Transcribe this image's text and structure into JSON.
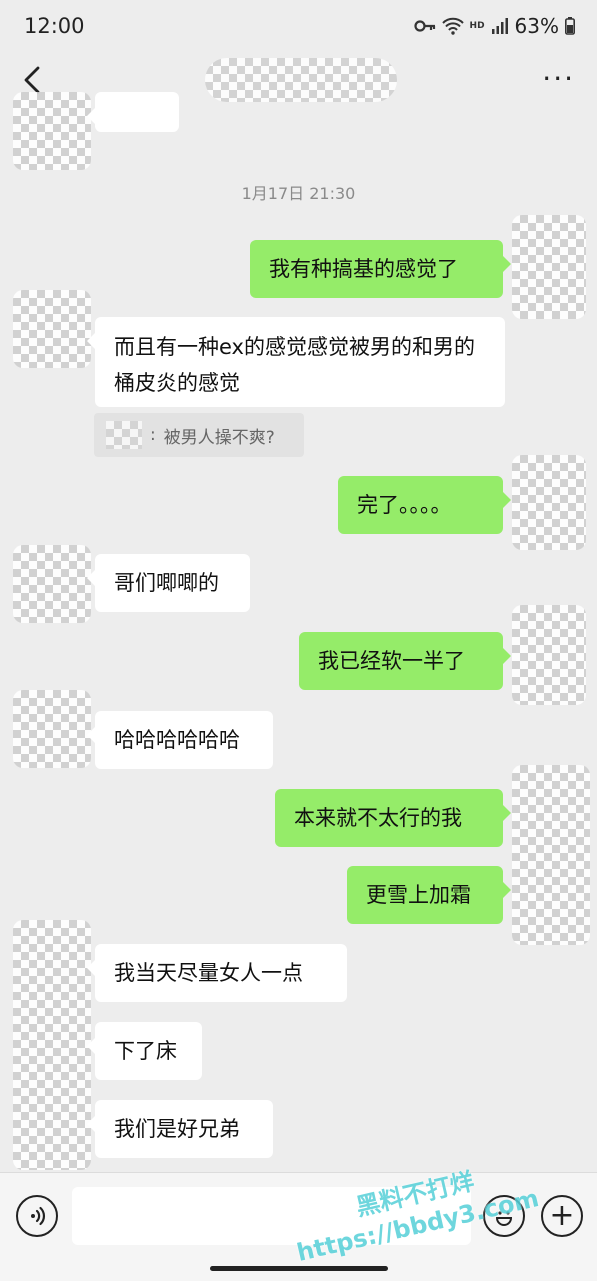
{
  "status": {
    "time": "12:00",
    "hd": "HD",
    "battery": "63%"
  },
  "header": {
    "back_icon": "chevron-left-icon",
    "more_icon": "more-dots-icon",
    "more_label": "···"
  },
  "timestamp": "1月17日 21:30",
  "messages": [
    {
      "text": "我有种搞基的感觉了"
    },
    {
      "text": "而且有一种ex的感觉感觉被男的和男的桶皮炎的感觉"
    },
    {
      "text": "完了。。。。"
    },
    {
      "text": "哥们唧唧的"
    },
    {
      "text": "我已经软一半了"
    },
    {
      "text": "哈哈哈哈哈哈"
    },
    {
      "text": "本来就不太行的我"
    },
    {
      "text": "更雪上加霜"
    },
    {
      "text": "我当天尽量女人一点"
    },
    {
      "text": "下了床"
    },
    {
      "text": "我们是好兄弟"
    }
  ],
  "quote": {
    "separator": ":",
    "text": "被男人操不爽?"
  },
  "input": {
    "voice_icon": "voice-icon",
    "emoji_icon": "emoji-icon",
    "plus_icon": "plus-icon",
    "plus_label": "+"
  },
  "watermark": {
    "line1": "黑料不打烊",
    "line2": "https://bbdy3.com"
  }
}
